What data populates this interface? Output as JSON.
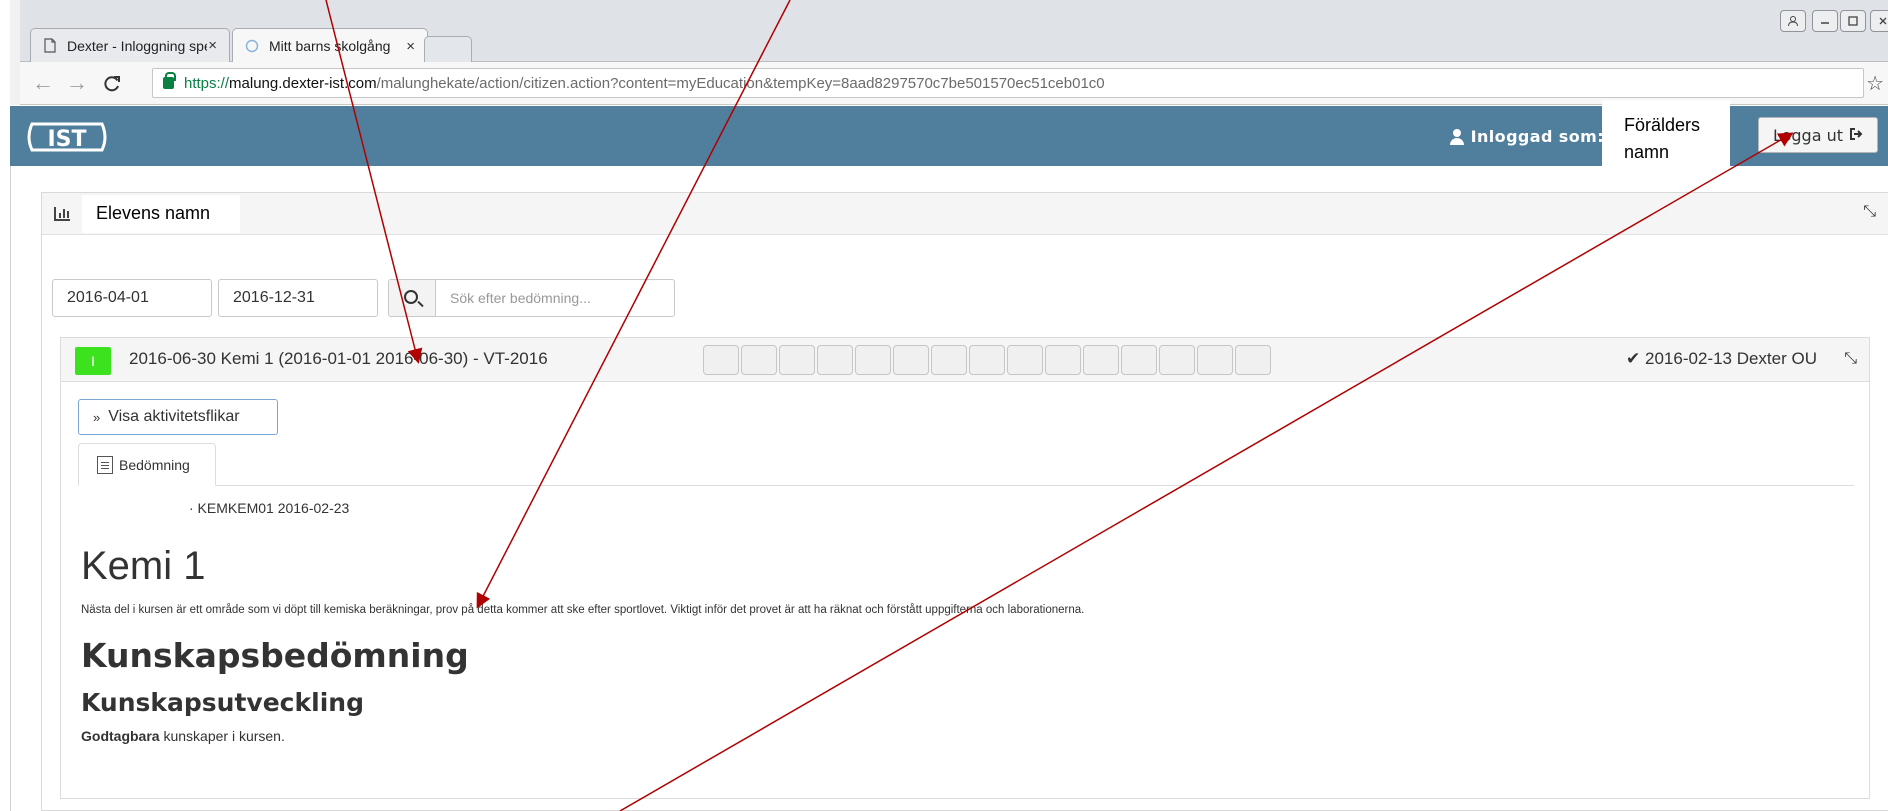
{
  "browser": {
    "tabs": [
      {
        "title": "Dexter - Inloggning spec",
        "close": "×"
      },
      {
        "title": "Mitt barns skolgång",
        "close": "×"
      }
    ],
    "url_scheme": "https://",
    "url_host": "malung.dexter-ist.com",
    "url_path": "/malunghekate/action/citizen.action?content=myEducation&tempKey=8aad8297570c7be501570ec51ceb01c0"
  },
  "header": {
    "logo_text": "IST",
    "logged_in_label": "Inloggad som:",
    "parent_name_line1": "Förälders",
    "parent_name_line2": "namn",
    "logout_label": "Logga ut"
  },
  "panel": {
    "student_name": "Elevens namn",
    "date_from": "2016-04-01",
    "date_to": "2016-12-31",
    "search_placeholder": "Sök efter bedömning..."
  },
  "course": {
    "grade": "I",
    "title": "2016-06-30 Kemi 1 (2016-01-01 2016-06-30) - VT-2016",
    "signed": "✔ 2016-02-13 Dexter OU",
    "show_activity_label": "Visa aktivitetsflikar",
    "tab_label": "Bedömning",
    "code_line": "· KEMKEM01 2016-02-23",
    "heading": "Kemi 1",
    "description": "Nästa del i kursen är ett område som vi döpt till kemiska beräkningar, prov på detta kommer att ske efter sportlovet. Viktigt inför det provet är att ha räknat och förstått uppgifterna och laborationerna.",
    "section_title": "Kunskapsbedömning",
    "subsection_title": "Kunskapsutveckling",
    "result_bold": "Godtagbara",
    "result_rest": " kunskaper i kursen."
  },
  "colors": {
    "header_bg": "#4f7f9d",
    "grade_badge": "#3de21f",
    "annotation_arrow": "#b00000"
  }
}
